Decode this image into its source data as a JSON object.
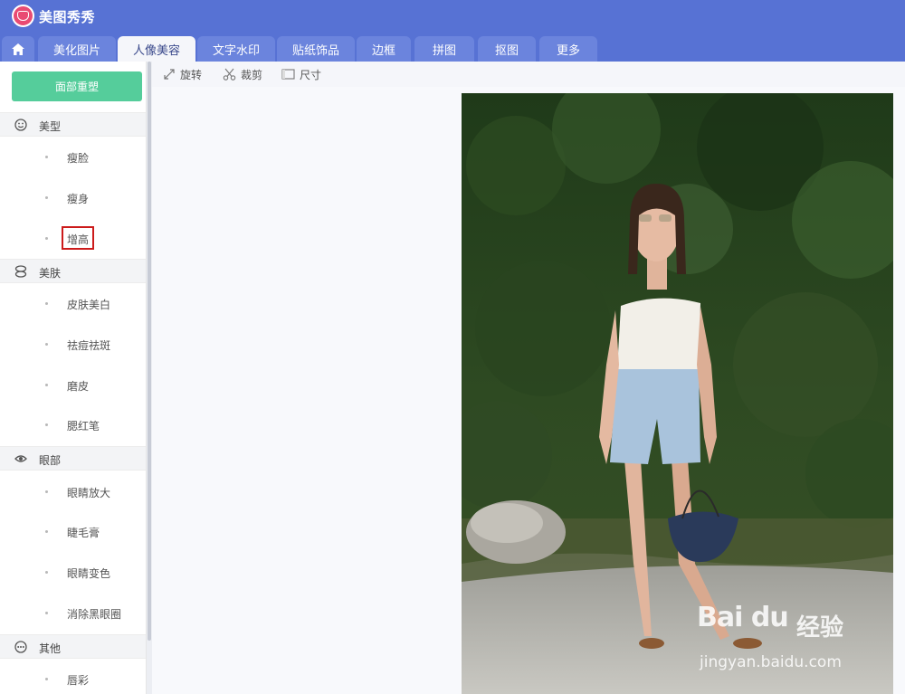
{
  "app": {
    "title": "美图秀秀"
  },
  "tabs": [
    {
      "label": "美化图片"
    },
    {
      "label": "人像美容",
      "active": true
    },
    {
      "label": "文字水印"
    },
    {
      "label": "贴纸饰品"
    },
    {
      "label": "边框"
    },
    {
      "label": "拼图"
    },
    {
      "label": "抠图"
    },
    {
      "label": "更多"
    }
  ],
  "sidebar": {
    "reset_label": "面部重塑",
    "sections": [
      {
        "label": "美型",
        "icon": "smile-face-icon",
        "items": [
          "瘦脸",
          "瘦身",
          "增高"
        ]
      },
      {
        "label": "美肤",
        "icon": "skin-drops-icon",
        "items": [
          "皮肤美白",
          "祛痘祛斑",
          "磨皮",
          "腮红笔"
        ]
      },
      {
        "label": "眼部",
        "icon": "eye-icon",
        "items": [
          "眼睛放大",
          "睫毛膏",
          "眼睛变色",
          "消除黑眼圈"
        ]
      },
      {
        "label": "其他",
        "icon": "more-dots-icon",
        "items": [
          "唇彩"
        ]
      }
    ],
    "highlighted_item": "增高"
  },
  "toolbar": {
    "rotate_label": "旋转",
    "crop_label": "裁剪",
    "size_label": "尺寸"
  },
  "watermark": {
    "logo": "Bai du",
    "cn": "经验",
    "url": "jingyan.baidu.com"
  },
  "colors": {
    "header": "#5772d4",
    "tab": "#6b84dd",
    "accent_green": "#55cd9b",
    "highlight_red": "#cc1b1b"
  }
}
